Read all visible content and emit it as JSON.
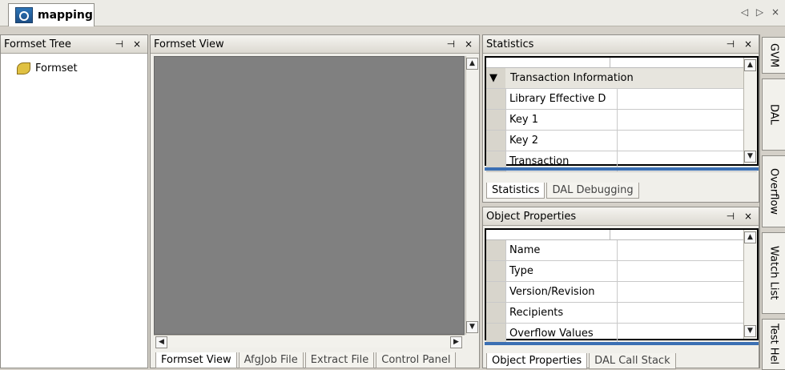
{
  "document_tab": {
    "label": "mapping"
  },
  "top_controls": {
    "left": "◁",
    "right": "▷",
    "close": "×"
  },
  "panels": {
    "formset_tree": {
      "title": "Formset Tree",
      "pin": "⊣",
      "close": "×",
      "items": [
        {
          "label": "Formset"
        }
      ]
    },
    "formset_view": {
      "title": "Formset View",
      "pin": "⊣",
      "close": "×"
    },
    "statistics": {
      "title": "Statistics",
      "pin": "⊣",
      "close": "×",
      "group": "Transaction Information",
      "rows": [
        "Library Effective D",
        "Key 1",
        "Key 2",
        "Transaction"
      ],
      "tabs": [
        "Statistics",
        "DAL Debugging"
      ]
    },
    "object_properties": {
      "title": "Object Properties",
      "pin": "⊣",
      "close": "×",
      "rows": [
        "Name",
        "Type",
        "Version/Revision",
        "Recipients",
        "Overflow Values"
      ],
      "tabs": [
        "Object Properties",
        "DAL Call Stack"
      ]
    }
  },
  "bottom_tabs": [
    "Formset View",
    "AfgJob File",
    "Extract File",
    "Control Panel"
  ],
  "right_rail_tabs": [
    "GVM",
    "DAL",
    "Overflow",
    "Watch List",
    "Test Hel"
  ],
  "colors": {
    "canvas": "#808080",
    "chrome": "#d4d0c8",
    "panel": "#ffffff"
  }
}
